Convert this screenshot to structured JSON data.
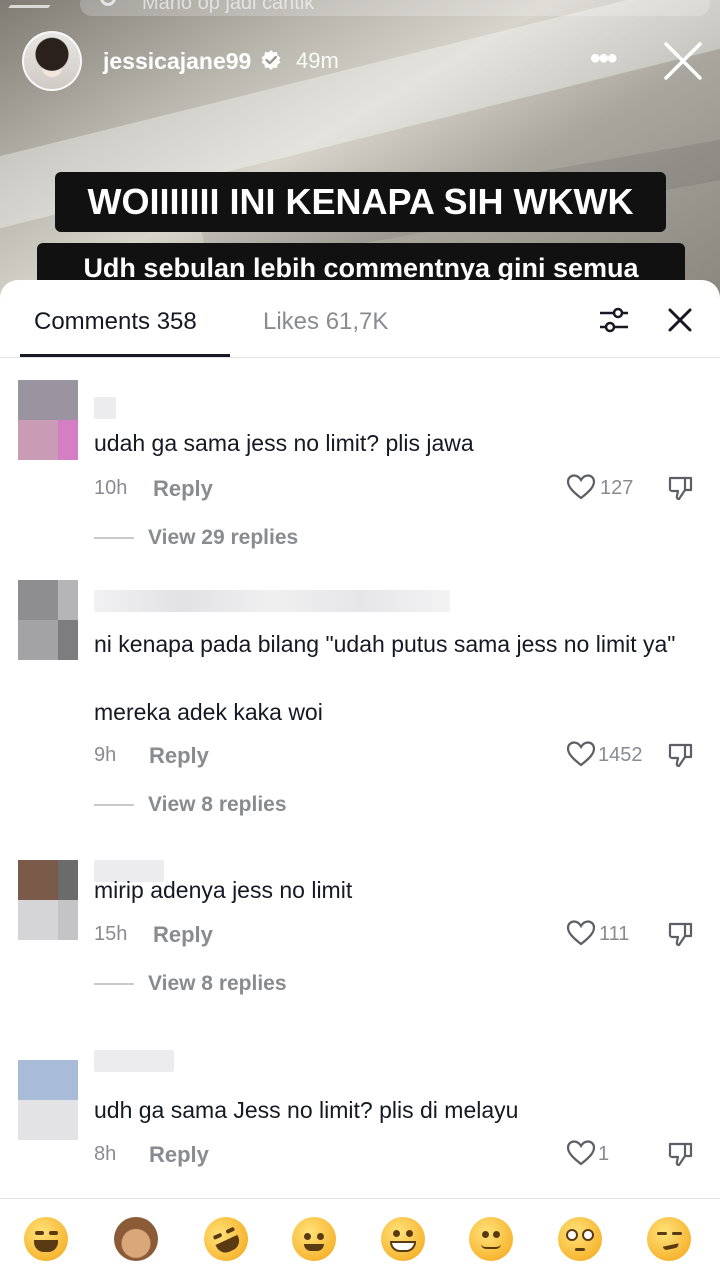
{
  "video": {
    "search_hint": "Mario op jadi cantik",
    "username": "jessicajane99",
    "time_ago": "49m",
    "more_icon": "more-dots-icon",
    "caption_line1": "WOIIIIIII INI KENAPA SIH WKWK",
    "caption_line2": "Udh sebulan lebih commentnya gini semua"
  },
  "sheet": {
    "tab_comments": "Comments 358",
    "tab_likes": "Likes 61,7K"
  },
  "comments": [
    {
      "text": "udah ga sama jess no limit? plis jawa",
      "time": "10h",
      "reply_label": "Reply",
      "likes": "127",
      "view_replies": "View 29 replies"
    },
    {
      "text": "ni kenapa pada bilang \"udah putus sama jess no limit ya\"",
      "text2": "mereka adek kaka woi",
      "time": "9h",
      "reply_label": "Reply",
      "likes": "1452",
      "view_replies": "View 8 replies"
    },
    {
      "text": "mirip adenya jess no limit",
      "time": "15h",
      "reply_label": "Reply",
      "likes": "111",
      "view_replies": "View 8 replies"
    },
    {
      "text": "udh ga sama Jess no limit? plis di melayu",
      "time": "8h",
      "reply_label": "Reply",
      "likes": "1"
    }
  ],
  "emoji_bar": [
    "face-with-tears-of-joy",
    "see-no-evil-monkey",
    "rolling-on-floor-laughing",
    "smiling-face-with-hearts",
    "grinning-face",
    "slightly-smiling-face",
    "flushed-face",
    "smirking-face"
  ],
  "colors": {
    "text_primary": "#161823",
    "text_secondary": "#8a8b91",
    "caption_bg": "#111111"
  }
}
